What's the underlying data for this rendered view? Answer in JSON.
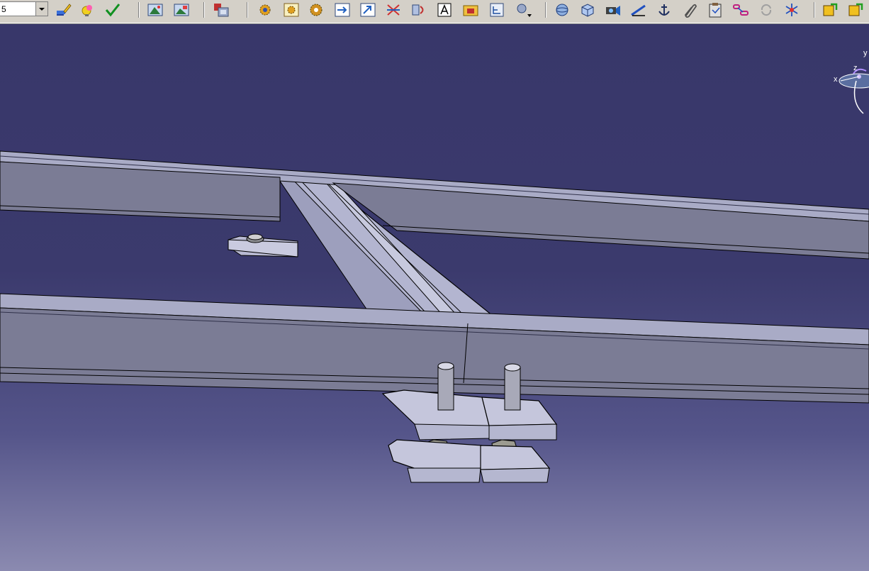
{
  "toolbar": {
    "combo_value": "5",
    "icons": [
      "paint-brush-icon",
      "light-bulb-icon",
      "check-mark-icon",
      "image-tool-icon",
      "image-tool-2-icon",
      "component-icon",
      "gear-1-icon",
      "gear-2-icon",
      "gear-3-icon",
      "arrow-tool-icon",
      "arrow-tool-2-icon",
      "cross-arrows-icon",
      "rotate-icon",
      "text-annotation-icon",
      "folder-icon",
      "tree-icon",
      "drop-menu-icon",
      "sphere-icon",
      "cube-icon",
      "camera-icon",
      "measure-icon",
      "anchor-icon",
      "paperclip-icon",
      "clipboard-icon",
      "chain-icon",
      "refresh-icon",
      "snowflake-icon",
      "save-icon",
      "save-2-icon"
    ]
  },
  "compass": {
    "x_label": "x",
    "y_label": "y",
    "z_label": "z"
  },
  "colors": {
    "background_top": "#38376a",
    "background_bottom": "#8b8ab0",
    "beam_face": "#7b7c95",
    "beam_top": "#a9abc6",
    "plate_face": "#c5c6dc"
  }
}
